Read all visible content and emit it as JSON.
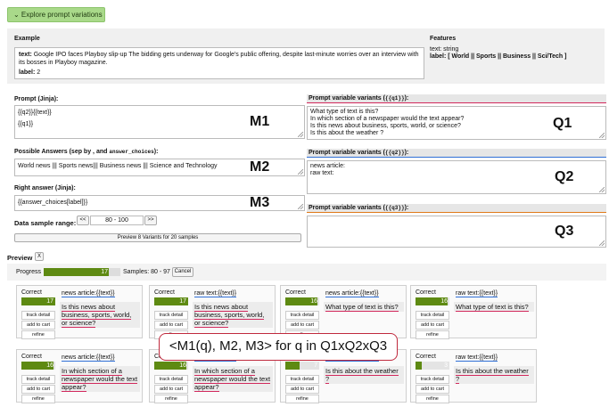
{
  "toggle_label": "⌄ Explore prompt variations",
  "example": {
    "title": "Example",
    "text_label": "text:",
    "text_value": "Google IPO faces Playboy slip-up The bidding gets underway for Google's public offering, despite last-minute worries over an interview with its bosses in Playboy magazine.",
    "label_label": "label:",
    "label_value": "2"
  },
  "features": {
    "title": "Features",
    "text_line": "text: string",
    "label_line": "label: [ World || Sports || Business || Sci/Tech ]"
  },
  "prompt": {
    "title": "Prompt (Jinja):",
    "line1": "{{q2}}{{text}}",
    "line2": "{{q1}}",
    "marker": "M1"
  },
  "answers": {
    "title": "Possible Answers (sep by , and answer_choices):",
    "value": "World news ||| Sports news||| Business news  ||| Science and Technology",
    "marker": "M2"
  },
  "right": {
    "title": "Right answer (Jinja):",
    "value": "{{answer_choices[label]}}",
    "marker": "M3"
  },
  "range": {
    "label": "Data sample range:",
    "prev": "<<",
    "value": "80 - 100",
    "next": ">>"
  },
  "preview_button": "Preview 8 Variants for 20 samples",
  "q1": {
    "title": "Prompt variable variants ({{q1}}):",
    "lines": [
      "What type of text is this?",
      "In which section of a newspaper would the text appear?",
      "Is this news about business, sports, world, or science?",
      "Is this about the weather ?"
    ],
    "marker": "Q1"
  },
  "q2": {
    "title": "Prompt variable variants ({{q2}}):",
    "lines": [
      "news article:",
      "raw text:"
    ],
    "marker": "Q2"
  },
  "q3": {
    "title": "Prompt variable variants ({{q3}}):",
    "marker": "Q3"
  },
  "preview": {
    "title": "Preview",
    "close": "X",
    "progress_label": "Progress",
    "progress_value": "17",
    "progress_fraction": 0.85,
    "samples": "Samples: 80 - 97",
    "cancel": "Cancel"
  },
  "overlay_text": "<M1(q), M2, M3> for q in Q1xQ2xQ3",
  "cards": [
    {
      "correct": "Correct",
      "num": "17",
      "frac": 1.0,
      "prompt": "news article:{{text}}",
      "answer": "Is this news about business, sports, world, or science?",
      "b1": "track detail",
      "b2": "add to cart",
      "b3": "refine"
    },
    {
      "correct": "Correct",
      "num": "17",
      "frac": 1.0,
      "prompt": "raw text:{{text}}",
      "answer": "Is this news about business, sports, world, or science?",
      "b1": "track detail",
      "b2": "add to cart",
      "b3": "refine"
    },
    {
      "correct": "Correct",
      "num": "16",
      "frac": 0.94,
      "prompt": "news article:{{text}}",
      "answer": "What type of text is this?",
      "b1": "track detail",
      "b2": "add to cart",
      "b3": "refine"
    },
    {
      "correct": "Correct",
      "num": "16",
      "frac": 0.94,
      "prompt": "raw text:{{text}}",
      "answer": "What type of text is this?",
      "b1": "track detail",
      "b2": "add to cart",
      "b3": "refine"
    },
    {
      "correct": "Correct",
      "num": "16",
      "frac": 0.94,
      "prompt": "news article:{{text}}",
      "answer": "In which section of a newspaper would the text appear?",
      "b1": "track detail",
      "b2": "add to cart",
      "b3": "refine"
    },
    {
      "correct": "Correct",
      "num": "16",
      "frac": 0.94,
      "prompt": "raw text:{{text}}",
      "answer": "In which section of a newspaper would the text appear?",
      "b1": "track detail",
      "b2": "add to cart",
      "b3": "refine"
    },
    {
      "correct": "Correct",
      "num": "7",
      "frac": 0.41,
      "prompt": "news article:{{text}}",
      "answer": "Is this about the weather ?",
      "b1": "track detail",
      "b2": "add to cart",
      "b3": "refine"
    },
    {
      "correct": "Correct",
      "num": "3",
      "frac": 0.18,
      "prompt": "raw text:{{text}}",
      "answer": "Is this about the weather ?",
      "b1": "track detail",
      "b2": "add to cart",
      "b3": "refine"
    }
  ],
  "colors": {
    "accent_green": "#5e8a12",
    "q1_line": "#d1285c",
    "q2_line": "#2f6fd6",
    "q3_line": "#e07b1a"
  }
}
